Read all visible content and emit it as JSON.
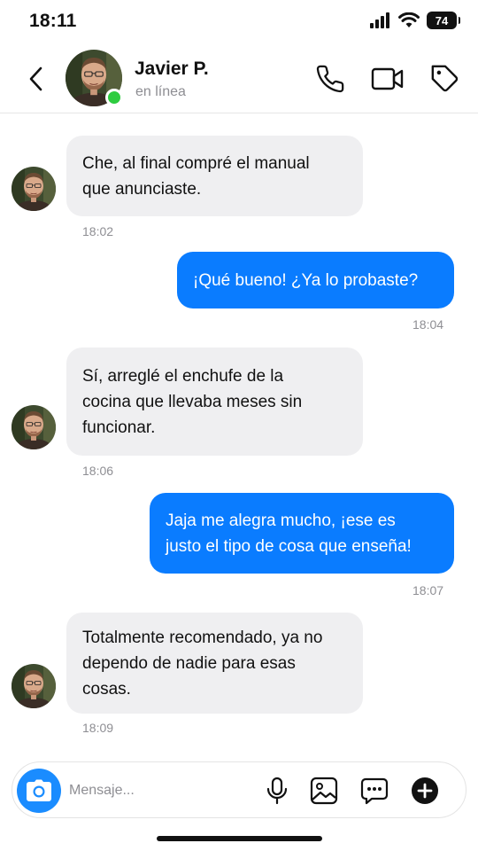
{
  "status_bar": {
    "time": "18:11",
    "battery": "74"
  },
  "header": {
    "name": "Javier P.",
    "status": "en línea"
  },
  "messages": [
    {
      "dir": "in",
      "lines": [
        "Che, al final compré el manual",
        "que anunciaste."
      ],
      "time": "18:02"
    },
    {
      "dir": "out",
      "lines": [
        "¡Qué bueno! ¿Ya lo probaste?"
      ],
      "time": "18:04"
    },
    {
      "dir": "in",
      "lines": [
        "Sí, arreglé el enchufe de la",
        "cocina que llevaba meses sin",
        "funcionar."
      ],
      "time": "18:06"
    },
    {
      "dir": "out",
      "lines": [
        "Jaja me alegra mucho, ¡ese es",
        "justo el tipo de cosa que enseña!"
      ],
      "time": "18:07"
    },
    {
      "dir": "in",
      "lines": [
        "Totalmente recomendado, ya no",
        "dependo de nadie para esas",
        "cosas."
      ],
      "time": "18:09"
    }
  ],
  "composer": {
    "placeholder": "Mensaje..."
  },
  "colors": {
    "outgoing": "#0a7cff",
    "incoming": "#efeff1",
    "online": "#2ecc40",
    "camera": "#1a8cff"
  }
}
